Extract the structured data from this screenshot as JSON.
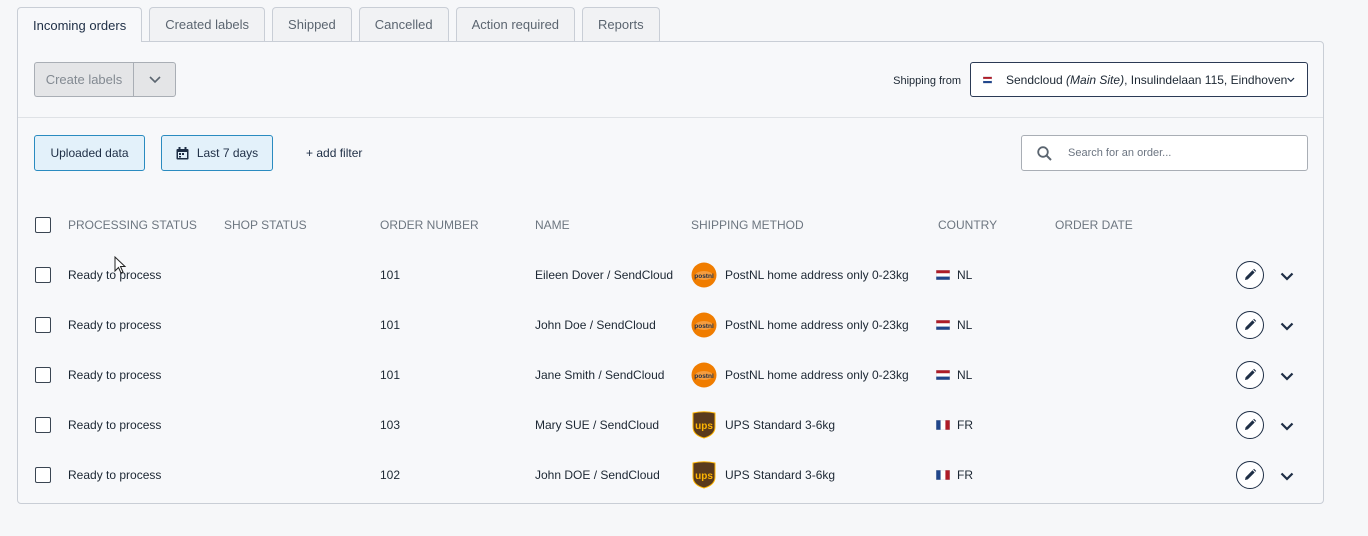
{
  "tabs": [
    "Incoming orders",
    "Created labels",
    "Shipped",
    "Cancelled",
    "Action required",
    "Reports"
  ],
  "toolbar": {
    "create_labels": "Create labels"
  },
  "shipping_from": {
    "label": "Shipping from",
    "site_name": "Sendcloud",
    "site_tag": "(Main Site)",
    "address": ", Insulindelaan 115, Eindhoven"
  },
  "filters": {
    "uploaded_data": "Uploaded data",
    "date_range": "Last 7 days",
    "add_filter": "+ add filter"
  },
  "search": {
    "placeholder": "Search for an order..."
  },
  "columns": {
    "processing_status": "PROCESSING STATUS",
    "shop_status": "SHOP STATUS",
    "order_number": "ORDER NUMBER",
    "name": "NAME",
    "shipping_method": "SHIPPING METHOD",
    "country": "COUNTRY",
    "order_date": "ORDER DATE"
  },
  "rows": [
    {
      "status": "Ready to process",
      "order": "101",
      "name": "Eileen Dover / SendCloud",
      "carrier": "postnl",
      "method": "PostNL home address only 0-23kg",
      "country": "NL"
    },
    {
      "status": "Ready to process",
      "order": "101",
      "name": "John Doe / SendCloud",
      "carrier": "postnl",
      "method": "PostNL home address only 0-23kg",
      "country": "NL"
    },
    {
      "status": "Ready to process",
      "order": "101",
      "name": "Jane Smith / SendCloud",
      "carrier": "postnl",
      "method": "PostNL home address only 0-23kg",
      "country": "NL"
    },
    {
      "status": "Ready to process",
      "order": "103",
      "name": "Mary SUE / SendCloud",
      "carrier": "ups",
      "method": "UPS Standard 3-6kg",
      "country": "FR"
    },
    {
      "status": "Ready to process",
      "order": "102",
      "name": "John DOE / SendCloud",
      "carrier": "ups",
      "method": "UPS Standard 3-6kg",
      "country": "FR"
    }
  ],
  "colors": {
    "accent": "#1e2e45",
    "filter_border": "#2a8bc0",
    "filter_bg": "#e3f1fa",
    "postnl": "#f07d00",
    "ups_brown": "#5a3a1c",
    "ups_gold": "#ffb500"
  }
}
